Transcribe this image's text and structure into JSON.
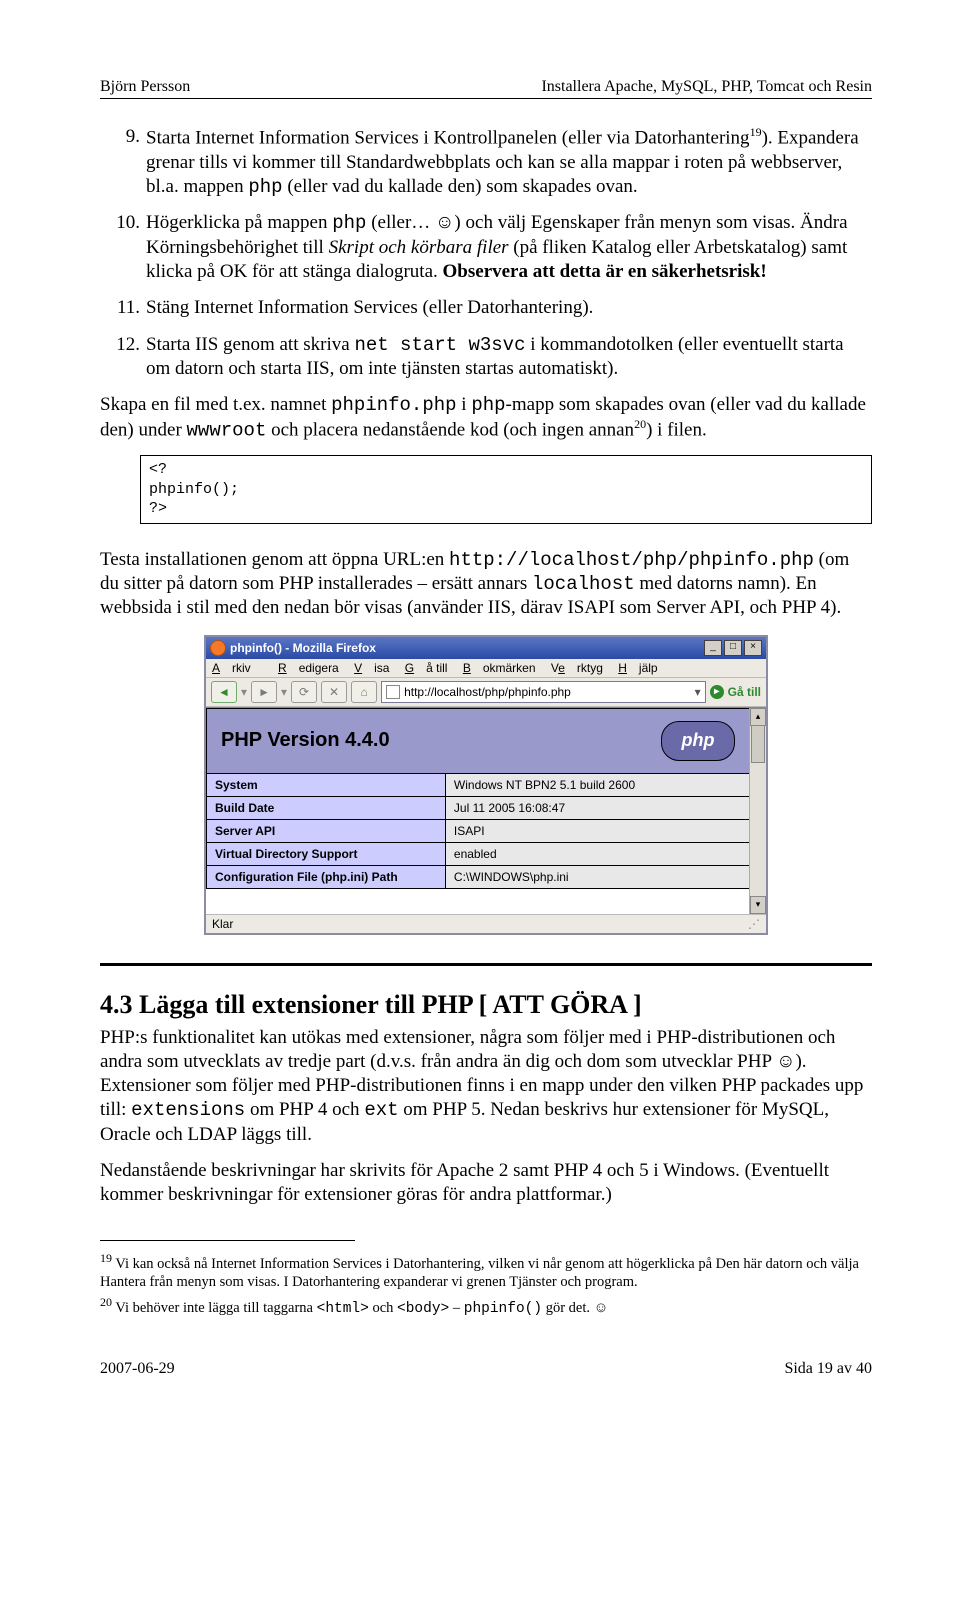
{
  "header": {
    "left": "Björn Persson",
    "right": "Installera Apache, MySQL, PHP, Tomcat och Resin"
  },
  "items": {
    "i9a": "Starta Internet Information Services i Kontrollpanelen (eller via Datorhantering",
    "i9sup": "19",
    "i9b": "). Expandera grenar tills vi kommer till Standardwebbplats och kan se alla mappar i roten på webbserver, bl.a. mappen ",
    "i9c": " (eller vad du kallade den) som skapades ovan.",
    "i10a": "Högerklicka på mappen ",
    "i10b": " (eller… ☺) och välj Egenskaper från menyn som visas. Ändra Körningsbehörighet till ",
    "i10ital": "Skript och körbara filer",
    "i10c": " (på fliken Katalog eller Arbetskatalog) samt klicka på OK för att stänga dialogruta. ",
    "i10bold": "Observera att detta är en säkerhetsrisk!",
    "i11": "Stäng Internet Information Services (eller Datorhantering).",
    "i12a": "Starta IIS genom att skriva ",
    "i12cmd": "net start w3svc",
    "i12b": " i kommandotolken (eller eventuellt starta om datorn och starta IIS, om inte tjänsten startas automatiskt)."
  },
  "mono": {
    "php": "php"
  },
  "para1": {
    "a": "Skapa en fil med t.ex. namnet ",
    "m1": "phpinfo.php",
    "b": " i ",
    "m2": "php",
    "c": "-mapp som skapades ovan (eller vad du kallade den) under ",
    "m3": "wwwroot",
    "d": " och placera nedanstående kod (och ingen annan",
    "sup": "20",
    "e": ") i filen."
  },
  "code": {
    "l1": "<?",
    "l2": "  phpinfo();",
    "l3": "?>"
  },
  "para2": {
    "a": "Testa installationen genom att öppna URL:en ",
    "m1": "http://localhost/php/phpinfo.php",
    "b": " (om du sitter på datorn som PHP installerades – ersätt annars ",
    "m2": "localhost",
    "c": " med datorns namn). En webbsida i stil med den nedan bör visas (använder IIS, därav ISAPI som Server API, och PHP 4)."
  },
  "browser": {
    "title": "phpinfo() - Mozilla Firefox",
    "menu": {
      "m1": "Arkiv",
      "m2": "Redigera",
      "m3": "Visa",
      "m4": "Gå till",
      "m5": "Bokmärken",
      "m6": "Verktyg",
      "m7": "Hjälp"
    },
    "url": "http://localhost/php/phpinfo.php",
    "go": "Gå till",
    "phpver": "PHP Version 4.4.0",
    "rows": [
      {
        "k": "System",
        "v": "Windows NT BPN2 5.1 build 2600"
      },
      {
        "k": "Build Date",
        "v": "Jul 11 2005 16:08:47"
      },
      {
        "k": "Server API",
        "v": "ISAPI"
      },
      {
        "k": "Virtual Directory Support",
        "v": "enabled"
      },
      {
        "k": "Configuration File (php.ini) Path",
        "v": "C:\\WINDOWS\\php.ini"
      }
    ],
    "status": "Klar"
  },
  "h2": "4.3  Lägga till extensioner till PHP [ ATT GÖRA ]",
  "para3": {
    "a": "PHP:s funktionalitet kan utökas med extensioner, några som följer med i PHP-distributionen och andra som utvecklats av tredje part (d.v.s. från andra än dig och dom som utvecklar PHP ☺). Extensioner som följer med PHP-distributionen finns i en mapp under den vilken PHP packades upp till: ",
    "m1": "extensions",
    "b": " om PHP 4 och ",
    "m2": "ext",
    "c": " om PHP 5. Nedan beskrivs hur extensioner för MySQL, Oracle och LDAP läggs till."
  },
  "para4": "Nedanstående beskrivningar har skrivits för Apache 2 samt PHP 4 och 5 i Windows. (Eventuellt kommer beskrivningar för extensioner göras för andra plattformar.)",
  "fn19": {
    "sup": "19",
    "txt": " Vi kan också nå Internet Information Services i Datorhantering, vilken vi når genom att högerklicka på Den här datorn och välja Hantera från menyn som visas. I Datorhantering expanderar vi grenen Tjänster och program."
  },
  "fn20": {
    "sup": "20",
    "a": " Vi behöver inte lägga till taggarna ",
    "m1": "<html>",
    "b": " och ",
    "m2": "<body>",
    "c": " – ",
    "m3": "phpinfo()",
    "d": " gör det. ☺"
  },
  "footer": {
    "left": "2007-06-29",
    "right": "Sida 19 av 40"
  }
}
